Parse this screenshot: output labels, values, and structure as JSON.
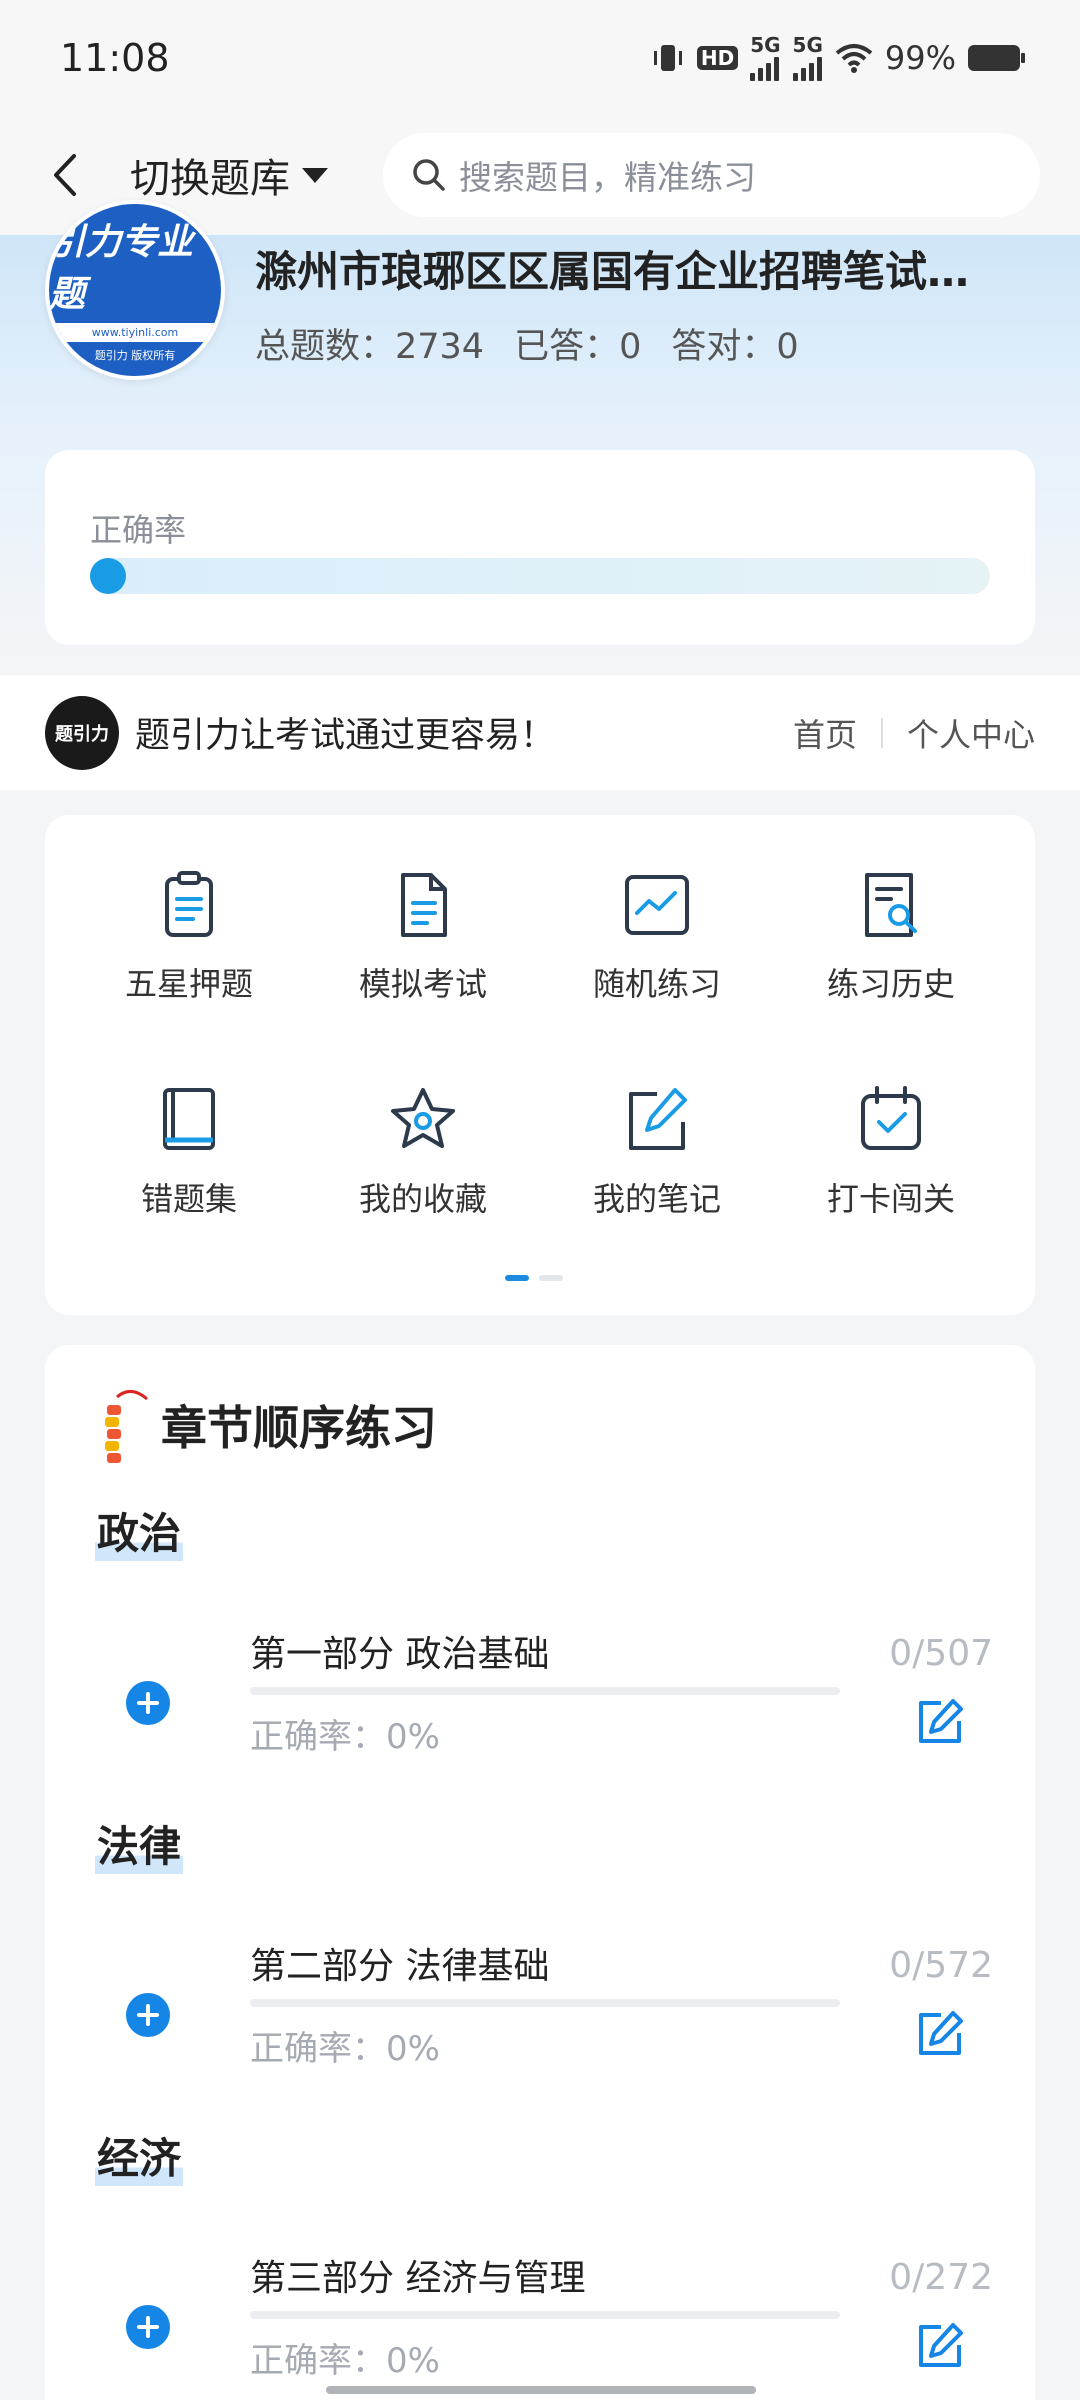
{
  "status_bar": {
    "time": "11:08",
    "battery": "99%",
    "hd_label": "HD",
    "sim1_label": "5G",
    "sim2_label": "5G"
  },
  "nav": {
    "switch_label": "切换题库",
    "search_placeholder": "搜索题目，精准练习"
  },
  "bank": {
    "logo_title": "引力专业题",
    "logo_url": "www.tiyinli.com",
    "logo_copyright": "题引力 版权所有",
    "title": "滁州市琅琊区区属国有企业招聘笔试…",
    "total_label": "总题数：2734",
    "answered_label": "已答：0",
    "correct_label": "答对：0"
  },
  "accuracy": {
    "label": "正确率",
    "value_fraction": 0
  },
  "slogan": {
    "logo_text": "题引力",
    "text": "题引力让考试通过更容易！",
    "home_link": "首页",
    "profile_link": "个人中心"
  },
  "features": [
    {
      "label": "五星押题",
      "icon": "clipboard-list-icon"
    },
    {
      "label": "模拟考试",
      "icon": "document-icon"
    },
    {
      "label": "随机练习",
      "icon": "line-chart-icon"
    },
    {
      "label": "练习历史",
      "icon": "document-search-icon"
    },
    {
      "label": "错题集",
      "icon": "book-icon"
    },
    {
      "label": "我的收藏",
      "icon": "star-icon"
    },
    {
      "label": "我的笔记",
      "icon": "edit-note-icon"
    },
    {
      "label": "打卡闯关",
      "icon": "calendar-check-icon"
    }
  ],
  "chapters": {
    "title": "章节顺序练习",
    "sections": [
      {
        "name": "政治",
        "chapter": "第一部分 政治基础",
        "accuracy": "正确率：0%",
        "count": "0/507"
      },
      {
        "name": "法律",
        "chapter": "第二部分 法律基础",
        "accuracy": "正确率：0%",
        "count": "0/572"
      },
      {
        "name": "经济",
        "chapter": "第三部分 经济与管理",
        "accuracy": "正确率：0%",
        "count": "0/272"
      }
    ]
  },
  "colors": {
    "accent": "#1a8be0",
    "icon_blue": "#1a9be6",
    "icon_dark": "#2c3a4b"
  }
}
